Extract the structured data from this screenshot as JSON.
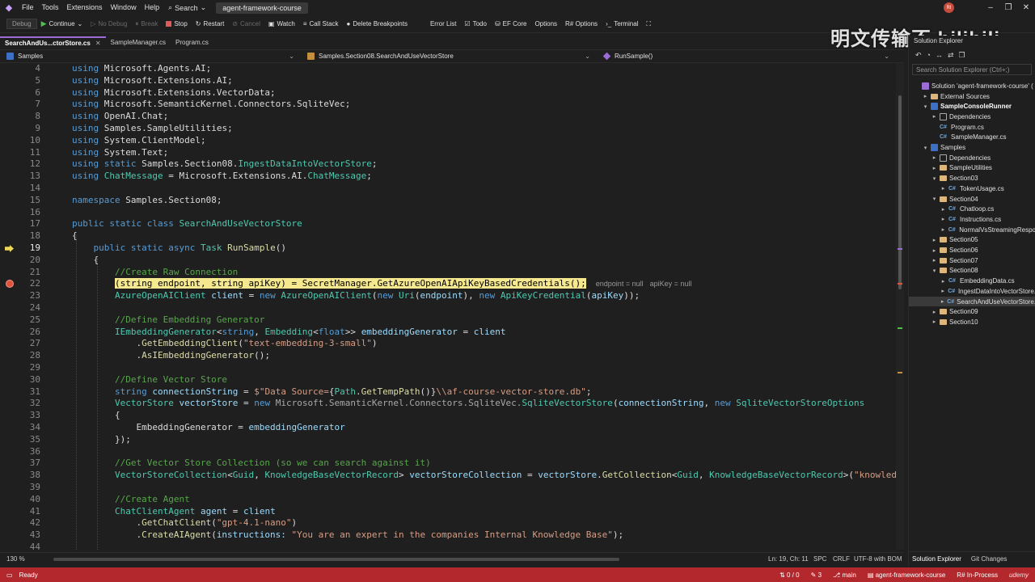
{
  "menu": {
    "items": [
      "File",
      "Tools",
      "Extensions",
      "Window",
      "Help"
    ],
    "search_label": "Search",
    "solution_name": "agent-framework-course",
    "avatar_initials": "RI"
  },
  "toolbar": {
    "config_dropdown": "Debug",
    "continue": "Continue",
    "no_debug": "No Debug",
    "break": "Break",
    "stop": "Stop",
    "restart": "Restart",
    "cancel": "Cancel",
    "watch": "Watch",
    "call_stack": "Call Stack",
    "delete_breakpoints": "Delete Breakpoints",
    "error_list": "Error List",
    "todo": "Todo",
    "ef_core": "EF Core",
    "options": "Options",
    "r_options": "R# Options",
    "terminal": "Terminal"
  },
  "watermark": "明文传输不 bilibili",
  "doc_tabs": [
    {
      "label": "SearchAndUs...ctorStore.cs",
      "active": true
    },
    {
      "label": "SampleManager.cs",
      "active": false
    },
    {
      "label": "Program.cs",
      "active": false
    }
  ],
  "nav": {
    "project": "Samples",
    "type": "Samples.Section08.SearchAndUseVectorStore",
    "member": "RunSample()"
  },
  "editor": {
    "hint_endpoint": "endpoint = null",
    "hint_apikey": "apiKey = null",
    "line_numbers": [
      "4",
      "5",
      "6",
      "7",
      "8",
      "9",
      "10",
      "11",
      "12",
      "13",
      "14",
      "15",
      "16",
      "17",
      "18",
      "19",
      "20",
      "21",
      "22",
      "23",
      "24",
      "25",
      "26",
      "27",
      "28",
      "29",
      "30",
      "31",
      "32",
      "33",
      "34",
      "35",
      "36",
      "37",
      "38",
      "39",
      "40",
      "41",
      "42",
      "43",
      "44"
    ],
    "current_line": "19"
  },
  "editor_status": {
    "zoom": "130 %",
    "position": "Ln: 19, Ch: 11",
    "spc": "SPC",
    "crlf": "CRLF",
    "encoding": "UTF-8 with BOM"
  },
  "solution_explorer": {
    "header": "Solution Explorer",
    "search_placeholder": "Search Solution Explorer (Ctrl+;)",
    "items": [
      {
        "label": "Solution 'agent-framework-course' (",
        "icon": "solution",
        "depth": 0,
        "twisty": "",
        "bold": false
      },
      {
        "label": "External Sources",
        "icon": "folder",
        "depth": 1,
        "twisty": "▸",
        "bold": false
      },
      {
        "label": "SampleConsoleRunner",
        "icon": "project",
        "depth": 1,
        "twisty": "▾",
        "bold": true
      },
      {
        "label": "Dependencies",
        "icon": "dep",
        "depth": 2,
        "twisty": "▸",
        "bold": false
      },
      {
        "label": "Program.cs",
        "icon": "cs",
        "depth": 2,
        "twisty": "",
        "bold": false
      },
      {
        "label": "SampleManager.cs",
        "icon": "cs",
        "depth": 2,
        "twisty": "",
        "bold": false
      },
      {
        "label": "Samples",
        "icon": "project",
        "depth": 1,
        "twisty": "▾",
        "bold": false
      },
      {
        "label": "Dependencies",
        "icon": "dep",
        "depth": 2,
        "twisty": "▸",
        "bold": false
      },
      {
        "label": "SampleUtilities",
        "icon": "folder",
        "depth": 2,
        "twisty": "▸",
        "bold": false
      },
      {
        "label": "Section03",
        "icon": "folder",
        "depth": 2,
        "twisty": "▾",
        "bold": false
      },
      {
        "label": "TokenUsage.cs",
        "icon": "cs",
        "depth": 3,
        "twisty": "▸",
        "bold": false
      },
      {
        "label": "Section04",
        "icon": "folder",
        "depth": 2,
        "twisty": "▾",
        "bold": false
      },
      {
        "label": "Chatloop.cs",
        "icon": "cs",
        "depth": 3,
        "twisty": "▸",
        "bold": false
      },
      {
        "label": "Instructions.cs",
        "icon": "cs",
        "depth": 3,
        "twisty": "▸",
        "bold": false
      },
      {
        "label": "NormalVsStreamingRespo",
        "icon": "cs",
        "depth": 3,
        "twisty": "▸",
        "bold": false
      },
      {
        "label": "Section05",
        "icon": "folder",
        "depth": 2,
        "twisty": "▸",
        "bold": false
      },
      {
        "label": "Section06",
        "icon": "folder",
        "depth": 2,
        "twisty": "▸",
        "bold": false
      },
      {
        "label": "Section07",
        "icon": "folder",
        "depth": 2,
        "twisty": "▸",
        "bold": false
      },
      {
        "label": "Section08",
        "icon": "folder",
        "depth": 2,
        "twisty": "▾",
        "bold": false
      },
      {
        "label": "EmbeddingData.cs",
        "icon": "cs",
        "depth": 3,
        "twisty": "▸",
        "bold": false
      },
      {
        "label": "IngestDataIntoVectorStore.",
        "icon": "cs",
        "depth": 3,
        "twisty": "▸",
        "bold": false
      },
      {
        "label": "SearchAndUseVectorStore.",
        "icon": "cs",
        "depth": 3,
        "twisty": "▸",
        "bold": false,
        "selected": true
      },
      {
        "label": "Section09",
        "icon": "folder",
        "depth": 2,
        "twisty": "▸",
        "bold": false
      },
      {
        "label": "Section10",
        "icon": "folder",
        "depth": 2,
        "twisty": "▸",
        "bold": false
      }
    ],
    "bottom_tabs": [
      "Solution Explorer",
      "Git Changes"
    ]
  },
  "statusbar": {
    "state": "Ready",
    "sync": "0 / 0",
    "edits": "3",
    "branch": "main",
    "repo": "agent-framework-course",
    "resharper": "R# In-Process",
    "udemy": "udemy"
  },
  "colors": {
    "statusbar": "#b3282d",
    "accent": "#9b6bd6",
    "highlight": "#f5e88f",
    "breakpoint": "#e0533a"
  }
}
